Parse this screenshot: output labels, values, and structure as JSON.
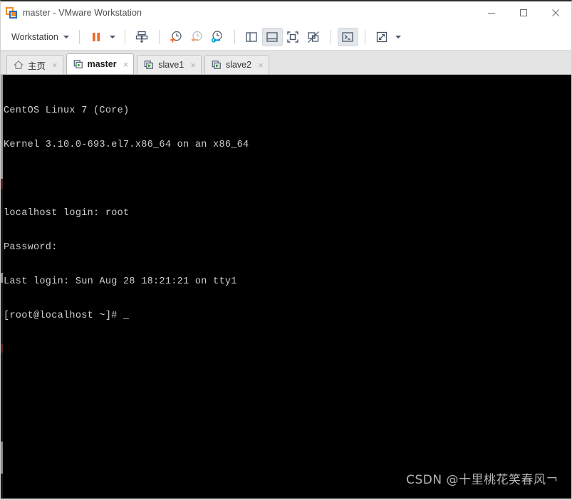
{
  "window": {
    "title": "master - VMware Workstation",
    "app_icon": "vmware-icon",
    "controls": {
      "minimize": "minimize-icon",
      "maximize": "maximize-icon",
      "close": "close-icon"
    }
  },
  "toolbar": {
    "menu_label": "Workstation",
    "menu_caret": "chevron-down-icon",
    "buttons": [
      {
        "name": "suspend-button",
        "icon": "pause-icon"
      },
      {
        "name": "power-dropdown-button",
        "icon": "chevron-down-icon"
      },
      {
        "name": "manage-button",
        "icon": "send-to-vm-icon"
      },
      {
        "name": "take-snapshot-button",
        "icon": "snapshot-add-icon"
      },
      {
        "name": "revert-snapshot-button",
        "icon": "snapshot-revert-icon"
      },
      {
        "name": "snapshot-manager-button",
        "icon": "snapshot-manager-icon"
      },
      {
        "name": "show-library-button",
        "icon": "sidebar-panel-icon"
      },
      {
        "name": "show-thumbnails-button",
        "icon": "thumbnail-bar-icon"
      },
      {
        "name": "fullscreen-button",
        "icon": "fullscreen-icon"
      },
      {
        "name": "unity-mode-button",
        "icon": "unity-mode-icon"
      },
      {
        "name": "console-view-button",
        "icon": "console-prompt-icon"
      },
      {
        "name": "stretch-guest-button",
        "icon": "stretch-arrows-icon"
      },
      {
        "name": "view-dropdown-button",
        "icon": "chevron-down-icon"
      }
    ]
  },
  "tabs": [
    {
      "label": "主页",
      "icon": "home-icon",
      "active": false,
      "close": "×"
    },
    {
      "label": "master",
      "icon": "vm-play-icon",
      "active": true,
      "close": "×"
    },
    {
      "label": "slave1",
      "icon": "vm-play-icon",
      "active": false,
      "close": "×"
    },
    {
      "label": "slave2",
      "icon": "vm-play-icon",
      "active": false,
      "close": "×"
    }
  ],
  "terminal": {
    "lines": [
      "CentOS Linux 7 (Core)",
      "Kernel 3.10.0-693.el7.x86_64 on an x86_64",
      "",
      "localhost login: root",
      "Password:",
      "Last login: Sun Aug 28 18:21:21 on tty1",
      "[root@localhost ~]# _"
    ],
    "background_color": "#000000",
    "text_color": "#cfcfcf"
  },
  "watermark": {
    "text": "CSDN @十里桃花笑春风￢"
  },
  "colors": {
    "accent_orange": "#f26522",
    "accent_blue": "#00a0d2",
    "icon_slate": "#46546a",
    "titlebar_bg": "#ffffff",
    "tabbar_bg": "#e4e4e4"
  }
}
